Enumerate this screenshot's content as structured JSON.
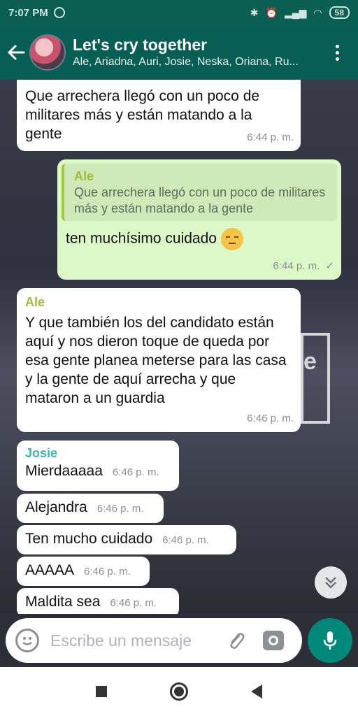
{
  "status_bar": {
    "time": "7:07 PM",
    "battery": "58"
  },
  "chat_header": {
    "title": "Let's cry together",
    "members": "Ale, Ariadna, Auri, Josie, Neska, Oriana, Ru..."
  },
  "messages": [
    {
      "type": "incoming",
      "sender": "",
      "text": "Que arrechera llegó con un poco de militares más y están matando a la gente",
      "time": "6:44 p. m."
    },
    {
      "type": "outgoing",
      "quote_sender": "Ale",
      "quote_text": "Que arrechera llegó con un poco de militares más y están matando a la gente",
      "text": "ten muchísimo cuidado",
      "emoji": "pensive-face",
      "time": "6:44 p. m.",
      "status": "✓"
    },
    {
      "type": "incoming",
      "sender": "Ale",
      "text": "Y que también los del candidato están aquí y nos dieron toque de queda por esa gente planea meterse para las casa y la gente de aquí arrecha y que mataron a un guardia",
      "time": "6:46 p. m."
    },
    {
      "type": "incoming",
      "sender": "Josie",
      "text": "Mierdaaaaa",
      "time": "6:46 p. m."
    },
    {
      "type": "incoming",
      "sender": "",
      "text": "Alejandra",
      "time": "6:46 p. m."
    },
    {
      "type": "incoming",
      "sender": "",
      "text": "Ten mucho cuidado",
      "time": "6:46 p. m."
    },
    {
      "type": "incoming",
      "sender": "",
      "text": "AAAAA",
      "time": "6:46 p. m."
    },
    {
      "type": "incoming",
      "sender": "",
      "text": "Maldita sea",
      "time": "6:46 p. m."
    }
  ],
  "background_sign_text": "e",
  "composer": {
    "placeholder": "Escribe un mensaje"
  },
  "colors": {
    "header": "#075e54",
    "outgoing_bubble": "#dcf8c6",
    "incoming_bubble": "#ffffff",
    "ale_name": "#a4b83a",
    "josie_name": "#3fb5ad",
    "fab": "#00897b"
  }
}
